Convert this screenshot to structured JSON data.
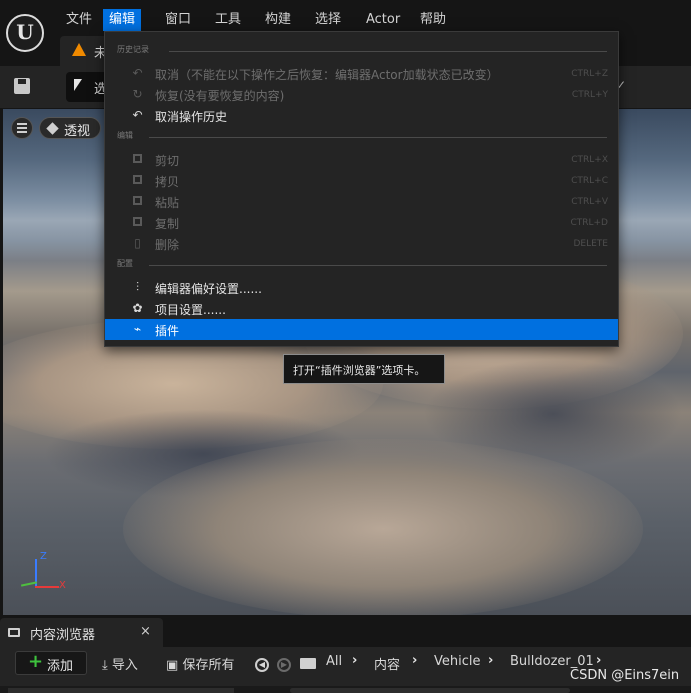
{
  "menubar": {
    "items": [
      "文件",
      "编辑",
      "窗口",
      "工具",
      "构建",
      "选择",
      "Actor",
      "帮助"
    ],
    "active": "编辑"
  },
  "doc_tab": {
    "label": "未"
  },
  "toolbar": {
    "select_label": "选"
  },
  "viewport": {
    "perspective_label": "透视",
    "axis_z": "Z",
    "axis_x": "X"
  },
  "edit_menu": {
    "sections": {
      "history": "历史记录",
      "edit": "编辑",
      "config": "配置"
    },
    "history_items": [
      {
        "label": "取消（不能在以下操作之后恢复：编辑器Actor加载状态已改变）",
        "shortcut": "CTRL+Z",
        "enabled": false,
        "icon": "undo-icon"
      },
      {
        "label": "恢复(没有要恢复的内容)",
        "shortcut": "CTRL+Y",
        "enabled": false,
        "icon": "redo-icon"
      },
      {
        "label": "取消操作历史",
        "shortcut": "",
        "enabled": true,
        "icon": "undo-history-icon"
      }
    ],
    "edit_items": [
      {
        "label": "剪切",
        "shortcut": "CTRL+X",
        "enabled": false,
        "icon": "cut-icon"
      },
      {
        "label": "拷贝",
        "shortcut": "CTRL+C",
        "enabled": false,
        "icon": "copy-icon"
      },
      {
        "label": "粘贴",
        "shortcut": "CTRL+V",
        "enabled": false,
        "icon": "paste-icon"
      },
      {
        "label": "复制",
        "shortcut": "CTRL+D",
        "enabled": false,
        "icon": "duplicate-icon"
      },
      {
        "label": "删除",
        "shortcut": "DELETE",
        "enabled": false,
        "icon": "delete-icon"
      }
    ],
    "config_items": [
      {
        "label": "编辑器偏好设置......",
        "enabled": true,
        "icon": "sliders-icon"
      },
      {
        "label": "项目设置......",
        "enabled": true,
        "icon": "project-settings-icon"
      },
      {
        "label": "插件",
        "enabled": true,
        "highlighted": true,
        "icon": "plugin-icon"
      }
    ]
  },
  "tooltip": {
    "text": "打开“插件浏览器”选项卡。"
  },
  "content_browser": {
    "tab_label": "内容浏览器",
    "close": "×",
    "add_label": "添加",
    "import_label": "导入",
    "save_all_label": "保存所有",
    "breadcrumb": [
      "All",
      "内容",
      "Vehicle",
      "Bulldozer_01"
    ]
  },
  "watermark": "CSDN @Eins7ein",
  "colors": {
    "accent": "#0070e0",
    "add_green": "#3ec33e",
    "warning": "#f08a00"
  }
}
